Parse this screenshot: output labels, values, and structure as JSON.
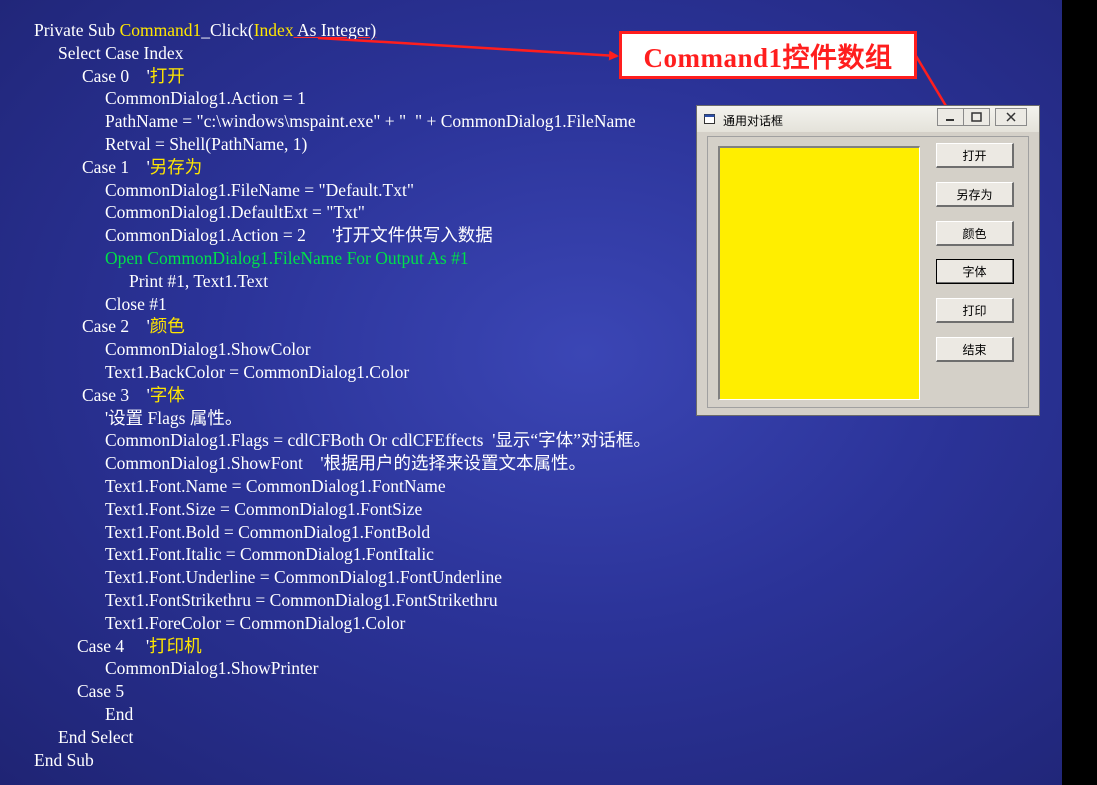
{
  "code": [
    {
      "indent": 34,
      "parts": [
        {
          "t": "Private Sub ",
          "c": "w"
        },
        {
          "t": "Command1",
          "c": "y"
        },
        {
          "t": "_Click(",
          "c": "w"
        },
        {
          "t": "Index",
          "c": "y"
        },
        {
          "t": " As Integer)",
          "c": "w",
          "u": true
        }
      ]
    },
    {
      "indent": 58,
      "parts": [
        {
          "t": "Select Case Index",
          "c": "w"
        }
      ]
    },
    {
      "indent": 82,
      "parts": [
        {
          "t": "Case 0    '",
          "c": "w"
        },
        {
          "t": "打开",
          "c": "y"
        }
      ]
    },
    {
      "indent": 105,
      "parts": [
        {
          "t": "CommonDialog1.Action = 1",
          "c": "w"
        }
      ]
    },
    {
      "indent": 105,
      "parts": [
        {
          "t": "PathName = \"c:\\windows\\mspaint.exe\" + \"  \" + CommonDialog1.FileName",
          "c": "w"
        }
      ]
    },
    {
      "indent": 105,
      "parts": [
        {
          "t": "Retval = Shell(PathName, 1)",
          "c": "w"
        }
      ]
    },
    {
      "indent": 82,
      "parts": [
        {
          "t": "Case 1    '",
          "c": "w"
        },
        {
          "t": "另存为",
          "c": "y"
        }
      ]
    },
    {
      "indent": 105,
      "parts": [
        {
          "t": "CommonDialog1.FileName = \"Default.Txt\"",
          "c": "w"
        }
      ]
    },
    {
      "indent": 105,
      "parts": [
        {
          "t": "CommonDialog1.DefaultExt = \"Txt\"",
          "c": "w"
        }
      ]
    },
    {
      "indent": 105,
      "parts": [
        {
          "t": "CommonDialog1.Action = 2      '打开文件供写入数据",
          "c": "w"
        }
      ]
    },
    {
      "indent": 105,
      "parts": [
        {
          "t": "Open CommonDialog1.FileName For Output As #1",
          "c": "g"
        }
      ]
    },
    {
      "indent": 129,
      "parts": [
        {
          "t": "Print #1, Text1.Text",
          "c": "w"
        }
      ]
    },
    {
      "indent": 105,
      "parts": [
        {
          "t": "Close #1",
          "c": "w"
        }
      ]
    },
    {
      "indent": 82,
      "parts": [
        {
          "t": "Case 2    '",
          "c": "w"
        },
        {
          "t": "颜色",
          "c": "y"
        }
      ]
    },
    {
      "indent": 105,
      "parts": [
        {
          "t": "CommonDialog1.ShowColor",
          "c": "w"
        }
      ]
    },
    {
      "indent": 105,
      "parts": [
        {
          "t": "Text1.BackColor = CommonDialog1.Color",
          "c": "w"
        }
      ]
    },
    {
      "indent": 82,
      "parts": [
        {
          "t": "Case 3    '",
          "c": "w"
        },
        {
          "t": "字体",
          "c": "y"
        }
      ]
    },
    {
      "indent": 105,
      "parts": [
        {
          "t": "'设置 Flags 属性。",
          "c": "w"
        }
      ]
    },
    {
      "indent": 105,
      "parts": [
        {
          "t": "CommonDialog1.Flags = cdlCFBoth Or cdlCFEffects  '显示“字体”对话框。",
          "c": "w"
        }
      ]
    },
    {
      "indent": 105,
      "parts": [
        {
          "t": "CommonDialog1.ShowFont    '根据用户的选择来设置文本属性。",
          "c": "w"
        }
      ]
    },
    {
      "indent": 105,
      "parts": [
        {
          "t": "Text1.Font.Name = CommonDialog1.FontName",
          "c": "w"
        }
      ]
    },
    {
      "indent": 105,
      "parts": [
        {
          "t": "Text1.Font.Size = CommonDialog1.FontSize",
          "c": "w"
        }
      ]
    },
    {
      "indent": 105,
      "parts": [
        {
          "t": "Text1.Font.Bold = CommonDialog1.FontBold",
          "c": "w"
        }
      ]
    },
    {
      "indent": 105,
      "parts": [
        {
          "t": "Text1.Font.Italic = CommonDialog1.FontItalic",
          "c": "w"
        }
      ]
    },
    {
      "indent": 105,
      "parts": [
        {
          "t": "Text1.Font.Underline = CommonDialog1.FontUnderline",
          "c": "w"
        }
      ]
    },
    {
      "indent": 105,
      "parts": [
        {
          "t": "Text1.FontStrikethru = CommonDialog1.FontStrikethru",
          "c": "w"
        }
      ]
    },
    {
      "indent": 105,
      "parts": [
        {
          "t": "Text1.ForeColor = CommonDialog1.Color",
          "c": "w"
        }
      ]
    },
    {
      "indent": 77,
      "parts": [
        {
          "t": "Case 4     '",
          "c": "w"
        },
        {
          "t": "打印机",
          "c": "y"
        }
      ]
    },
    {
      "indent": 105,
      "parts": [
        {
          "t": "CommonDialog1.ShowPrinter",
          "c": "w"
        }
      ]
    },
    {
      "indent": 77,
      "parts": [
        {
          "t": "Case 5",
          "c": "w"
        }
      ]
    },
    {
      "indent": 105,
      "parts": [
        {
          "t": "End",
          "c": "w"
        }
      ]
    },
    {
      "indent": 58,
      "parts": [
        {
          "t": "End Select",
          "c": "w"
        }
      ]
    },
    {
      "indent": 34,
      "parts": [
        {
          "t": "End Sub",
          "c": "w"
        }
      ]
    }
  ],
  "callout": {
    "text": "Command1控件数组"
  },
  "window": {
    "title": "通用对话框",
    "icon": "window-icon",
    "textbox_color": "#ffee00",
    "buttons": [
      {
        "label": "打开",
        "focused": false
      },
      {
        "label": "另存为",
        "focused": false
      },
      {
        "label": "颜色",
        "focused": false
      },
      {
        "label": "字体",
        "focused": true
      },
      {
        "label": "打印",
        "focused": false
      },
      {
        "label": "结束",
        "focused": false
      }
    ]
  },
  "colors": {
    "accent_red": "#ff1e1e",
    "keyword_yellow": "#ffe600",
    "code_green": "#00e04a"
  }
}
